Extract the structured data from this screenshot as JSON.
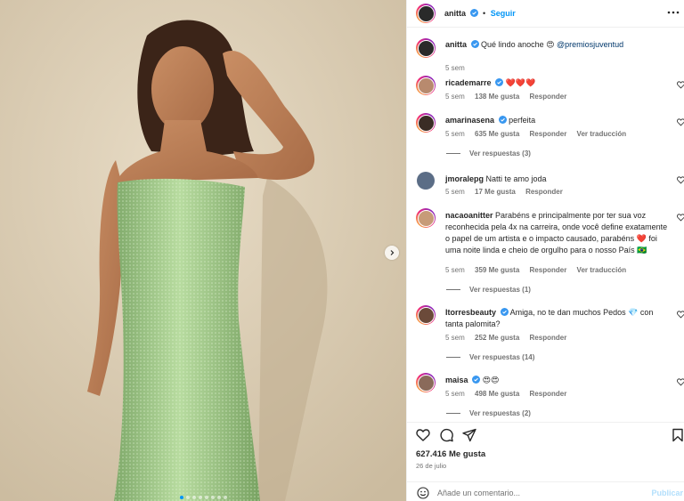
{
  "post": {
    "author": "anitta",
    "follow_label": "Seguir",
    "caption": {
      "username": "anitta",
      "text": "Qué lindo anoche 😍 ",
      "mention": "@premiosjuventud",
      "time": "5 sem"
    },
    "carousel": {
      "slide_count": 8,
      "active_index": 0
    }
  },
  "comments": [
    {
      "username": "ricademarre",
      "verified": true,
      "text": "❤️❤️❤️",
      "time": "5 sem",
      "likes": "138 Me gusta",
      "reply": "Responder",
      "translate": "",
      "view_replies": ""
    },
    {
      "username": "amarinasena",
      "verified": true,
      "text": "perfeita",
      "time": "5 sem",
      "likes": "635 Me gusta",
      "reply": "Responder",
      "translate": "Ver traducción",
      "view_replies": "Ver respuestas (3)"
    },
    {
      "username": "jmoralepg",
      "verified": false,
      "text": "Natti te amo joda",
      "time": "5 sem",
      "likes": "17 Me gusta",
      "reply": "Responder",
      "translate": "",
      "view_replies": ""
    },
    {
      "username": "nacaoanitter",
      "verified": false,
      "text": "Parabéns e principalmente por ter sua voz reconhecida pela 4x na carreira, onde você define exatamente o papel de um artista e o impacto causado, parabéns ❤️ foi uma noite linda e cheio de orgulho para o nosso País 🇧🇷",
      "time": "5 sem",
      "likes": "359 Me gusta",
      "reply": "Responder",
      "translate": "Ver traducción",
      "view_replies": "Ver respuestas (1)"
    },
    {
      "username": "ltorresbeauty",
      "verified": true,
      "text": "Amiga, no te dan muchos Pedos 💎 con tanta palomita?",
      "time": "5 sem",
      "likes": "252 Me gusta",
      "reply": "Responder",
      "translate": "",
      "view_replies": "Ver respuestas (14)"
    },
    {
      "username": "maisa",
      "verified": true,
      "text": "😍😍",
      "time": "5 sem",
      "likes": "498 Me gusta",
      "reply": "Responder",
      "translate": "",
      "view_replies": "Ver respuestas (2)"
    }
  ],
  "footer": {
    "likes": "627.416 Me gusta",
    "date": "26 de julio",
    "comment_placeholder": "Añade un comentario...",
    "publish_label": "Publicar"
  },
  "colors": {
    "accent": "#0095f6",
    "verified": "#3897f0",
    "dress": "#9cc482",
    "background": "#d9cbb3"
  },
  "icons": [
    "heart-icon",
    "comment-icon",
    "share-icon",
    "bookmark-icon",
    "emoji-icon",
    "more-icon",
    "chevron-right-icon",
    "verified-icon"
  ]
}
